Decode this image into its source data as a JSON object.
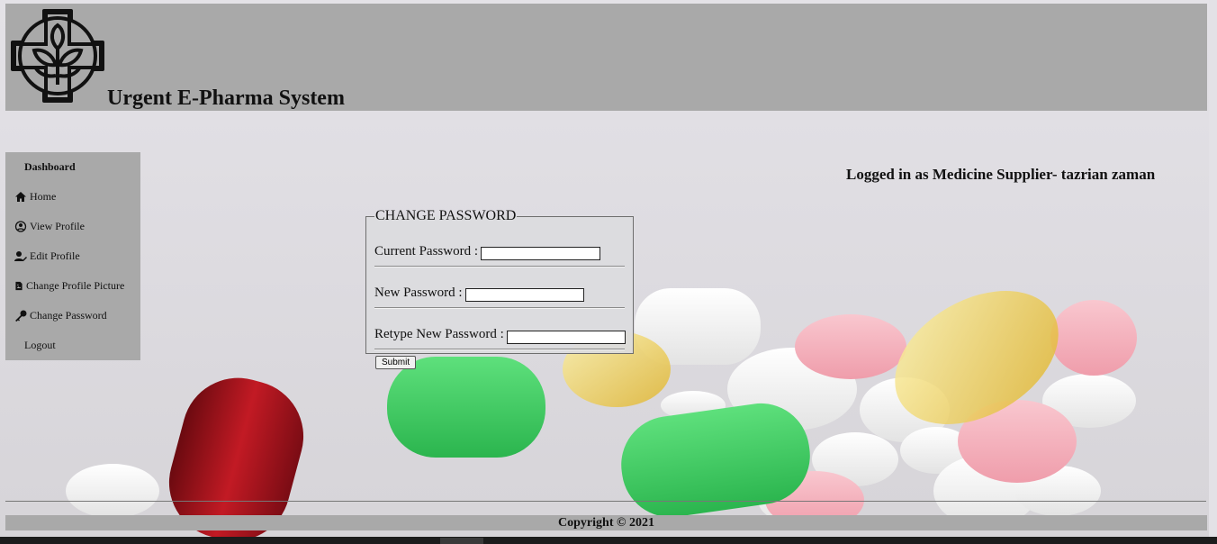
{
  "header": {
    "site_title": "Urgent E-Pharma System",
    "logo_icon": "pharmacy-cross-leaf-logo"
  },
  "sidebar": {
    "items": [
      {
        "label": "Dashboard",
        "icon": ""
      },
      {
        "label": "Home",
        "icon": "home-icon"
      },
      {
        "label": "View Profile",
        "icon": "user-circle-icon"
      },
      {
        "label": "Edit Profile",
        "icon": "user-edit-icon"
      },
      {
        "label": "Change Profile Picture",
        "icon": "file-image-icon"
      },
      {
        "label": "Change Password",
        "icon": "key-icon"
      },
      {
        "label": "Logout",
        "icon": ""
      }
    ]
  },
  "status": {
    "logged_in_text": "Logged in as Medicine Supplier- tazrian zaman"
  },
  "change_password_form": {
    "legend": "CHANGE PASSWORD",
    "current_password_label": "Current Password :",
    "current_password_value": "",
    "new_password_label": "New Password :",
    "new_password_value": "",
    "retype_password_label": "Retype New Password :",
    "retype_password_value": "",
    "submit_label": "Submit"
  },
  "footer": {
    "copyright": "Copyright © 2021"
  },
  "colors": {
    "header_bg": "#a9a9a9",
    "sidebar_bg": "#a9a9a9",
    "footer_bg": "#a9a9a9",
    "page_bg": "#dcdadf"
  }
}
